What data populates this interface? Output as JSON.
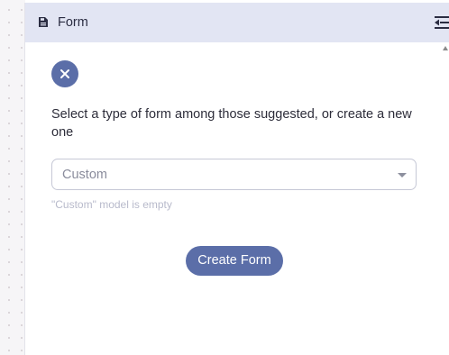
{
  "panel": {
    "title": "Form",
    "title_icon": "form-document-icon",
    "collapse_icon": "collapse-panel-icon"
  },
  "close_button": {
    "icon": "close-icon"
  },
  "instruction": "Select a type of form among those suggested, or create a new one",
  "model_select": {
    "value": "Custom",
    "icon": "caret-down-icon"
  },
  "hint": "\"Custom\" model is empty",
  "create_button": {
    "label": "Create Form"
  },
  "colors": {
    "header_background": "#e2e5f3",
    "accent": "#5b6ea8",
    "hint_text": "#b8bacb"
  }
}
